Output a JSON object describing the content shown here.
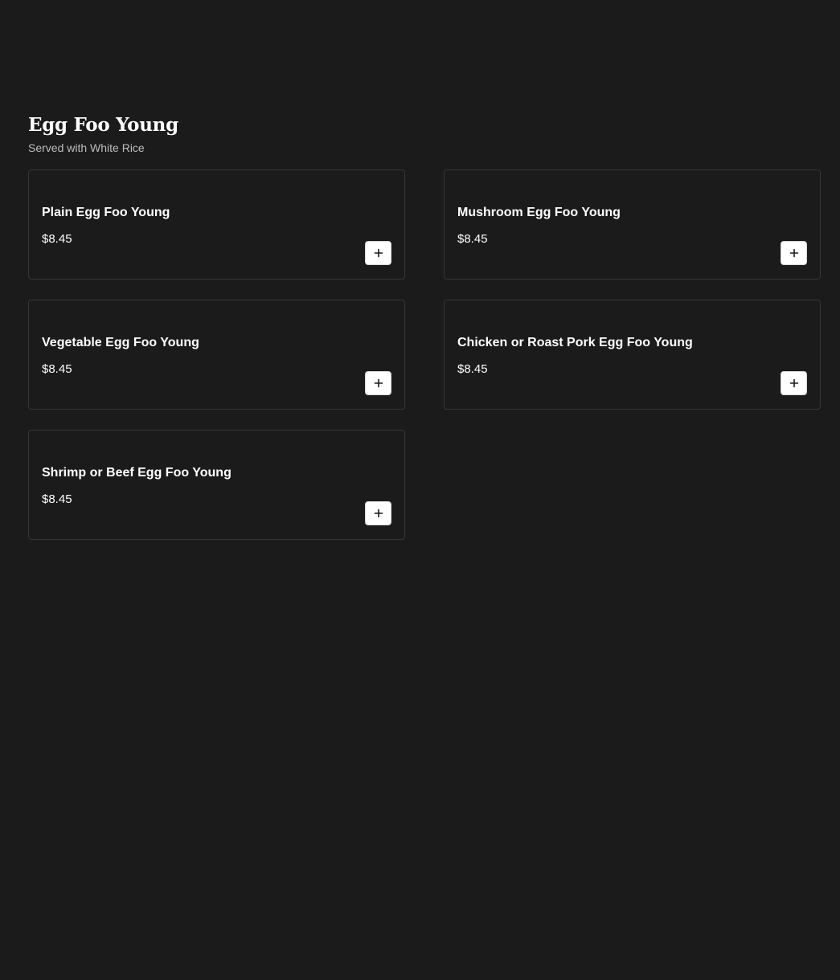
{
  "section": {
    "title": "Egg Foo Young",
    "subtitle": "Served with White Rice"
  },
  "items": [
    {
      "name": "Plain Egg Foo Young",
      "price": "$8.45",
      "action_icon": "plus-icon"
    },
    {
      "name": "Mushroom Egg Foo Young",
      "price": "$8.45",
      "action_icon": "plus-icon"
    },
    {
      "name": "Vegetable Egg Foo Young",
      "price": "$8.45",
      "action_icon": "plus-icon"
    },
    {
      "name": "Chicken or Roast Pork Egg Foo Young",
      "price": "$8.45",
      "action_icon": "plus-icon"
    },
    {
      "name": "Shrimp or Beef Egg Foo Young",
      "price": "$8.45",
      "action_icon": "plus-icon"
    }
  ],
  "colors": {
    "background": "#1b1b1b",
    "card_border": "#363636",
    "button_bg": "#ffffff",
    "text": "#ffffff",
    "subtitle_text": "#bdbdbd"
  }
}
